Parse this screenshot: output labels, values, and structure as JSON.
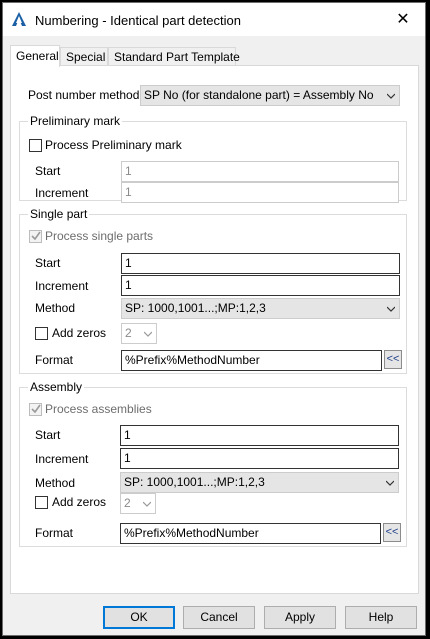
{
  "window": {
    "title": "Numbering - Identical part detection",
    "close_glyph": "✕"
  },
  "tabs": [
    {
      "label": "General"
    },
    {
      "label": "Special"
    },
    {
      "label": "Standard Part Template"
    }
  ],
  "post_number": {
    "label": "Post number method",
    "value": "SP No (for standalone part) = Assembly No"
  },
  "preliminary": {
    "group_title": "Preliminary mark",
    "checkbox_label": "Process Preliminary mark",
    "checked": false,
    "start_label": "Start",
    "start_value": "1",
    "increment_label": "Increment",
    "increment_value": "1"
  },
  "single_part": {
    "group_title": "Single part",
    "checkbox_label": "Process single parts",
    "checked": true,
    "start_label": "Start",
    "start_value": "1",
    "increment_label": "Increment",
    "increment_value": "1",
    "method_label": "Method",
    "method_value": "SP: 1000,1001...;MP:1,2,3",
    "add_zeros_label": "Add zeros",
    "add_zeros_checked": false,
    "zeros_value": "2",
    "format_label": "Format",
    "format_value": "%Prefix%MethodNumber",
    "format_button": "<<"
  },
  "assembly": {
    "group_title": "Assembly",
    "checkbox_label": "Process assemblies",
    "checked": true,
    "start_label": "Start",
    "start_value": "1",
    "increment_label": "Increment",
    "increment_value": "1",
    "method_label": "Method",
    "method_value": "SP: 1000,1001...;MP:1,2,3",
    "add_zeros_label": "Add zeros",
    "add_zeros_checked": false,
    "zeros_value": "2",
    "format_label": "Format",
    "format_value": "%Prefix%MethodNumber",
    "format_button": "<<"
  },
  "buttons": {
    "ok": "OK",
    "cancel": "Cancel",
    "apply": "Apply",
    "help": "Help"
  },
  "colors": {
    "accent": "#0078d7",
    "window_bg": "#f0f0f0",
    "panel_bg": "#ffffff"
  }
}
